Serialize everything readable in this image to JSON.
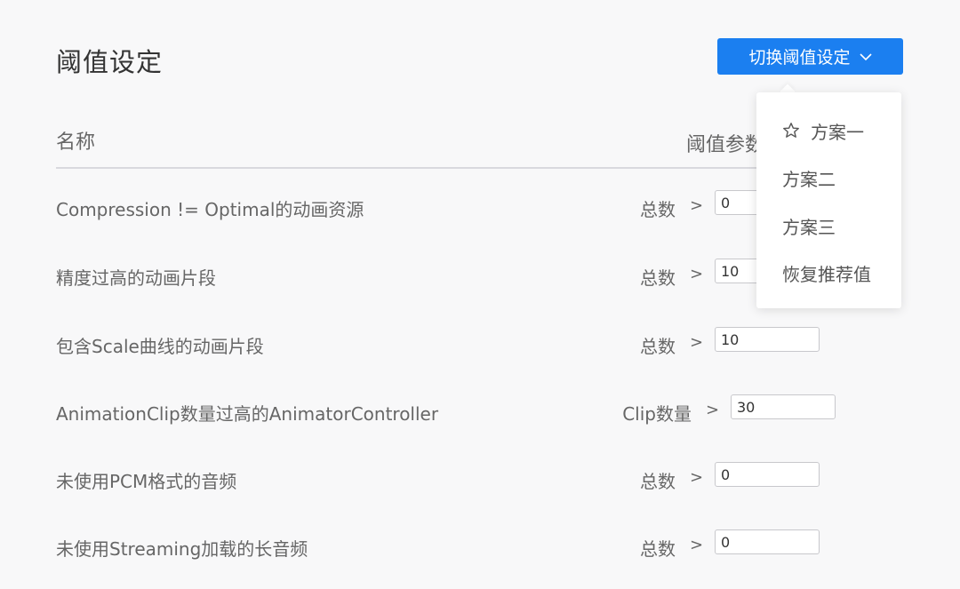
{
  "header": {
    "title": "阈值设定",
    "switch_button_label": "切换阈值设定"
  },
  "table": {
    "col_name": "名称",
    "col_params": "阈值参数"
  },
  "rows": [
    {
      "name": "Compression != Optimal的动画资源",
      "label": "总数",
      "op": ">",
      "value": "0"
    },
    {
      "name": "精度过高的动画片段",
      "label": "总数",
      "op": ">",
      "value": "10"
    },
    {
      "name": "包含Scale曲线的动画片段",
      "label": "总数",
      "op": ">",
      "value": "10"
    },
    {
      "name": "AnimationClip数量过高的AnimatorController",
      "label": "Clip数量",
      "op": ">",
      "value": "30"
    },
    {
      "name": "未使用PCM格式的音频",
      "label": "总数",
      "op": ">",
      "value": "0"
    },
    {
      "name": "未使用Streaming加载的长音频",
      "label": "总数",
      "op": ">",
      "value": "0"
    }
  ],
  "dropdown": {
    "items": [
      {
        "label": "方案一",
        "icon": "star-icon"
      },
      {
        "label": "方案二"
      },
      {
        "label": "方案三"
      },
      {
        "label": "恢复推荐值"
      }
    ]
  },
  "colors": {
    "accent": "#1b7ff0",
    "background": "#f8f8f9",
    "text": "#666666"
  }
}
